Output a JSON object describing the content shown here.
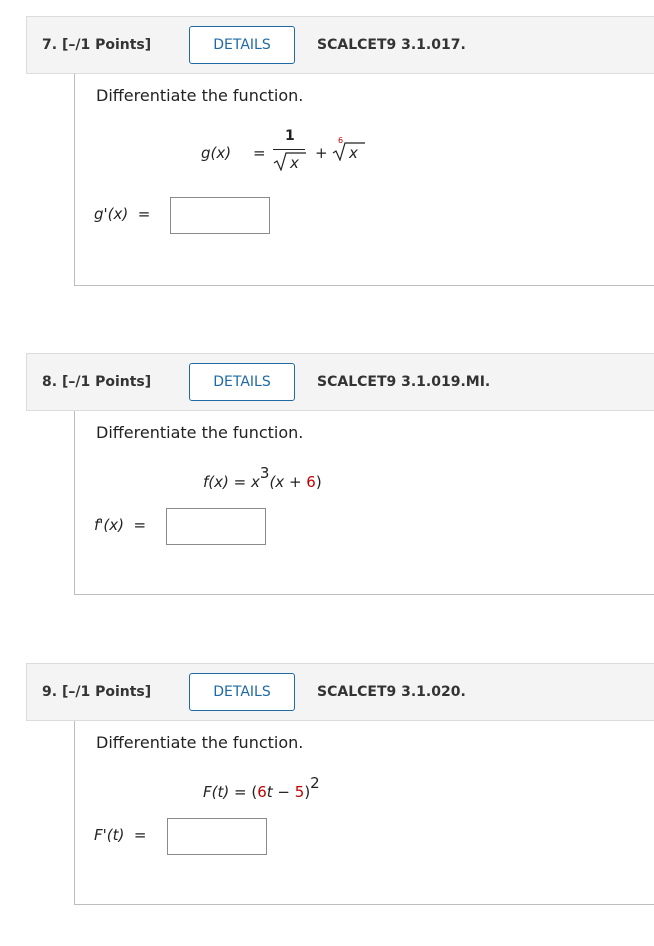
{
  "questions": [
    {
      "number": "7.",
      "points": "[–/1 Points]",
      "details_label": "DETAILS",
      "code": "SCALCET9 3.1.017.",
      "prompt": "Differentiate the function.",
      "function": {
        "lhs": "g(x)",
        "equals": "=",
        "numerator": "1",
        "denominator_radicand": "x",
        "plus": "+",
        "root_index": "6",
        "radicand": "x"
      },
      "answer_label": "g'(x)",
      "answer_equals": "=",
      "answer_value": ""
    },
    {
      "number": "8.",
      "points": "[–/1 Points]",
      "details_label": "DETAILS",
      "code": "SCALCET9 3.1.019.MI.",
      "prompt": "Differentiate the function.",
      "function": {
        "lhs": "f(x)",
        "equals": "=",
        "base": "x",
        "exponent": "3",
        "open": "(x + ",
        "constant": "6",
        "close": ")"
      },
      "answer_label": "f'(x)",
      "answer_equals": "=",
      "answer_value": ""
    },
    {
      "number": "9.",
      "points": "[–/1 Points]",
      "details_label": "DETAILS",
      "code": "SCALCET9 3.1.020.",
      "prompt": "Differentiate the function.",
      "function": {
        "lhs": "F(t)",
        "equals": "=",
        "open": "(",
        "coef": "6",
        "var": "t",
        "minus": " − ",
        "constant": "5",
        "close": ")",
        "exponent": "2"
      },
      "answer_label": "F'(t)",
      "answer_equals": "=",
      "answer_value": ""
    }
  ],
  "colors": {
    "accent": "#1f6aa5",
    "highlight": "#c00000",
    "header_bg": "#f4f4f4"
  }
}
